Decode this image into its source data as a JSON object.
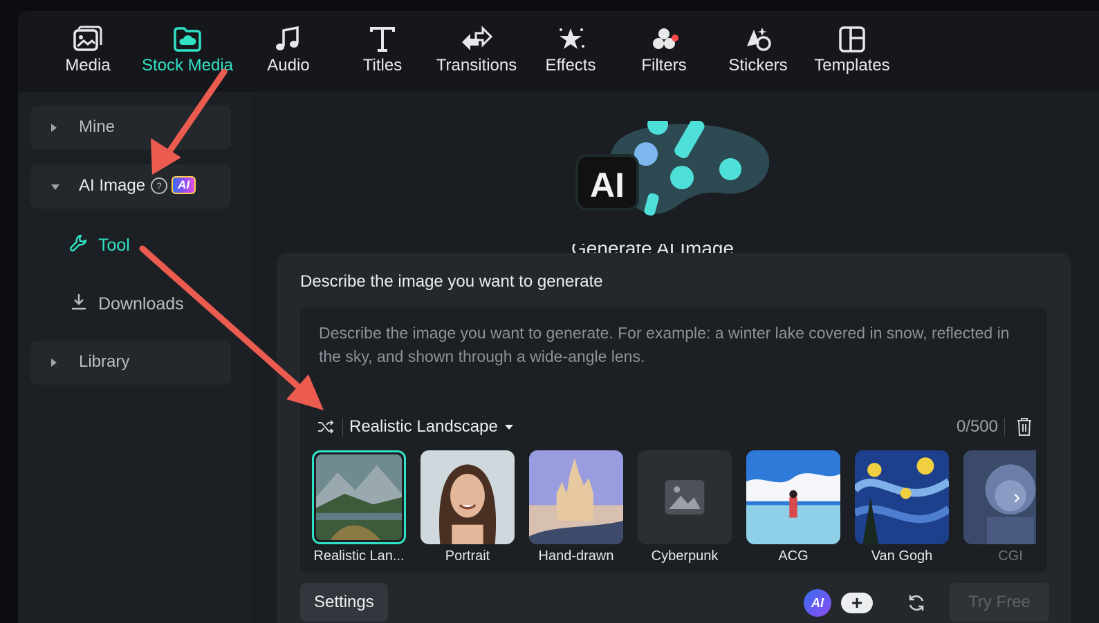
{
  "toolbar": {
    "tabs": [
      {
        "label": "Media",
        "icon": "media-icon"
      },
      {
        "label": "Stock Media",
        "icon": "stock-media-icon",
        "active": true
      },
      {
        "label": "Audio",
        "icon": "music-note-icon"
      },
      {
        "label": "Titles",
        "icon": "text-t-icon"
      },
      {
        "label": "Transitions",
        "icon": "transition-arrows-icon"
      },
      {
        "label": "Effects",
        "icon": "sparkle-star-icon"
      },
      {
        "label": "Filters",
        "icon": "filters-circles-icon",
        "notification": true
      },
      {
        "label": "Stickers",
        "icon": "sticker-icon"
      },
      {
        "label": "Templates",
        "icon": "templates-grid-icon"
      }
    ]
  },
  "sidebar": {
    "mine": "Mine",
    "ai_image": "AI Image",
    "ai_badge": "AI",
    "help_glyph": "?",
    "tool": "Tool",
    "downloads": "Downloads",
    "library": "Library"
  },
  "main": {
    "hero_ai_label": "AI",
    "hero_caption": "Generate AI Image",
    "panel_title": "Describe the image you want to generate",
    "prompt_placeholder": "Describe the image you want to generate. For example: a winter lake covered in snow, reflected in the sky, and shown through a wide-angle lens.",
    "prompt_value": "",
    "selected_style": "Realistic Landscape",
    "counter": "0/500",
    "styles": [
      {
        "name": "Realistic Lan...",
        "selected": true
      },
      {
        "name": "Portrait"
      },
      {
        "name": "Hand-drawn"
      },
      {
        "name": "Cyberpunk"
      },
      {
        "name": "ACG"
      },
      {
        "name": "Van Gogh"
      },
      {
        "name": "CGI",
        "faded": true
      }
    ],
    "next_glyph": "›",
    "settings_label": "Settings",
    "credits_ai": "AI",
    "plus_glyph": "+",
    "try_label": "Try Free"
  },
  "colors": {
    "accent": "#31e2c5",
    "annotation_arrow": "#ec5b4f",
    "notification_dot": "#ff4c4c"
  }
}
